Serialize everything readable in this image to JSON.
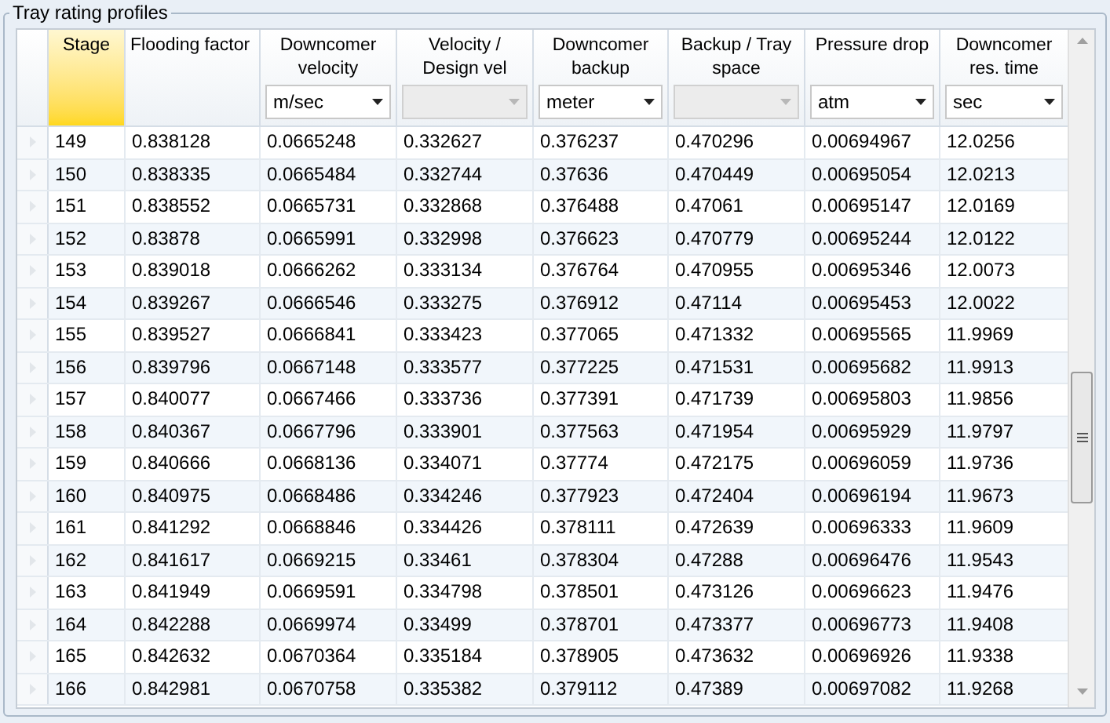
{
  "group_title": "Tray rating profiles",
  "table": {
    "columns": [
      {
        "label": "Stage",
        "selected": true
      },
      {
        "label": "Flooding factor",
        "selected": false
      },
      {
        "label": "Downcomer velocity",
        "selected": false,
        "unit": {
          "value": "m/sec",
          "disabled": false
        }
      },
      {
        "label": "Velocity / Design vel",
        "selected": false,
        "unit": {
          "disabled": true
        }
      },
      {
        "label": "Downcomer backup",
        "selected": false,
        "unit": {
          "value": "meter",
          "disabled": false
        }
      },
      {
        "label": "Backup / Tray space",
        "selected": false,
        "unit": {
          "disabled": true
        }
      },
      {
        "label": "Pressure drop",
        "selected": false,
        "unit": {
          "value": "atm",
          "disabled": false
        }
      },
      {
        "label": "Downcomer res. time",
        "selected": false,
        "unit": {
          "value": "sec",
          "disabled": false
        }
      }
    ],
    "rows": [
      [
        "149",
        "0.838128",
        "0.0665248",
        "0.332627",
        "0.376237",
        "0.470296",
        "0.00694967",
        "12.0256"
      ],
      [
        "150",
        "0.838335",
        "0.0665484",
        "0.332744",
        "0.37636",
        "0.470449",
        "0.00695054",
        "12.0213"
      ],
      [
        "151",
        "0.838552",
        "0.0665731",
        "0.332868",
        "0.376488",
        "0.47061",
        "0.00695147",
        "12.0169"
      ],
      [
        "152",
        "0.83878",
        "0.0665991",
        "0.332998",
        "0.376623",
        "0.470779",
        "0.00695244",
        "12.0122"
      ],
      [
        "153",
        "0.839018",
        "0.0666262",
        "0.333134",
        "0.376764",
        "0.470955",
        "0.00695346",
        "12.0073"
      ],
      [
        "154",
        "0.839267",
        "0.0666546",
        "0.333275",
        "0.376912",
        "0.47114",
        "0.00695453",
        "12.0022"
      ],
      [
        "155",
        "0.839527",
        "0.0666841",
        "0.333423",
        "0.377065",
        "0.471332",
        "0.00695565",
        "11.9969"
      ],
      [
        "156",
        "0.839796",
        "0.0667148",
        "0.333577",
        "0.377225",
        "0.471531",
        "0.00695682",
        "11.9913"
      ],
      [
        "157",
        "0.840077",
        "0.0667466",
        "0.333736",
        "0.377391",
        "0.471739",
        "0.00695803",
        "11.9856"
      ],
      [
        "158",
        "0.840367",
        "0.0667796",
        "0.333901",
        "0.377563",
        "0.471954",
        "0.00695929",
        "11.9797"
      ],
      [
        "159",
        "0.840666",
        "0.0668136",
        "0.334071",
        "0.37774",
        "0.472175",
        "0.00696059",
        "11.9736"
      ],
      [
        "160",
        "0.840975",
        "0.0668486",
        "0.334246",
        "0.377923",
        "0.472404",
        "0.00696194",
        "11.9673"
      ],
      [
        "161",
        "0.841292",
        "0.0668846",
        "0.334426",
        "0.378111",
        "0.472639",
        "0.00696333",
        "11.9609"
      ],
      [
        "162",
        "0.841617",
        "0.0669215",
        "0.33461",
        "0.378304",
        "0.47288",
        "0.00696476",
        "11.9543"
      ],
      [
        "163",
        "0.841949",
        "0.0669591",
        "0.334798",
        "0.378501",
        "0.473126",
        "0.00696623",
        "11.9476"
      ],
      [
        "164",
        "0.842288",
        "0.0669974",
        "0.33499",
        "0.378701",
        "0.473377",
        "0.00696773",
        "11.9408"
      ],
      [
        "165",
        "0.842632",
        "0.0670364",
        "0.335184",
        "0.378905",
        "0.473632",
        "0.00696926",
        "11.9338"
      ],
      [
        "166",
        "0.842981",
        "0.0670758",
        "0.335382",
        "0.379112",
        "0.47389",
        "0.00697082",
        "11.9268"
      ]
    ]
  }
}
